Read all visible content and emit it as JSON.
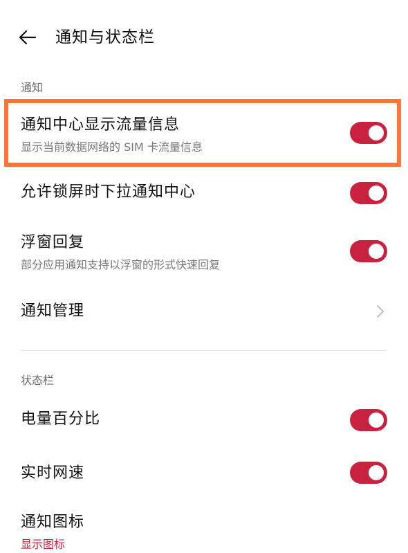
{
  "header": {
    "title": "通知与状态栏",
    "back_icon": "arrow-left-icon"
  },
  "sections": {
    "notification": {
      "label": "通知",
      "items": [
        {
          "title": "通知中心显示流量信息",
          "subtitle": "显示当前数据网络的 SIM 卡流量信息",
          "toggle": true
        },
        {
          "title": "允许锁屏时下拉通知中心",
          "toggle": true
        },
        {
          "title": "浮窗回复",
          "subtitle": "部分应用通知支持以浮窗的形式快速回复",
          "toggle": true
        },
        {
          "title": "通知管理",
          "chevron_icon": "chevron-right-icon"
        }
      ]
    },
    "statusbar": {
      "label": "状态栏",
      "items": [
        {
          "title": "电量百分比",
          "toggle": true
        },
        {
          "title": "实时网速",
          "toggle": true
        },
        {
          "title": "通知图标",
          "subtitle": "显示图标"
        }
      ]
    }
  },
  "colors": {
    "accent": "#c8223f",
    "highlight": "#ff7438",
    "text_primary": "#111111",
    "text_secondary": "#777777"
  }
}
